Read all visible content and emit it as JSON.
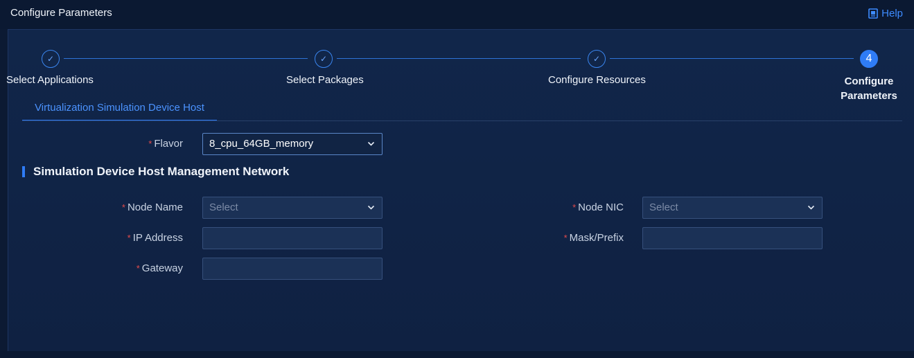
{
  "header": {
    "title": "Configure Parameters",
    "help_label": "Help"
  },
  "stepper": {
    "steps": [
      {
        "label": "Select Applications",
        "marker": "✓"
      },
      {
        "label": "Select Packages",
        "marker": "✓"
      },
      {
        "label": "Configure Resources",
        "marker": "✓"
      },
      {
        "label": "Configure Parameters",
        "marker": "4"
      }
    ],
    "current_step": 4
  },
  "tabs": [
    {
      "label": "Virtualization Simulation Device Host"
    }
  ],
  "form": {
    "required_mark": "*",
    "flavor": {
      "label": "Flavor",
      "value": "8_cpu_64GB_memory"
    },
    "section_title": "Simulation Device Host Management Network",
    "node_name": {
      "label": "Node Name",
      "placeholder": "Select"
    },
    "node_nic": {
      "label": "Node NIC",
      "placeholder": "Select"
    },
    "ip_address": {
      "label": "IP Address",
      "value": ""
    },
    "mask_prefix": {
      "label": "Mask/Prefix",
      "value": ""
    },
    "gateway": {
      "label": "Gateway",
      "value": ""
    }
  },
  "colors": {
    "accent": "#2f7cf6",
    "required": "#e34b4b",
    "background": "#0c1a33"
  }
}
